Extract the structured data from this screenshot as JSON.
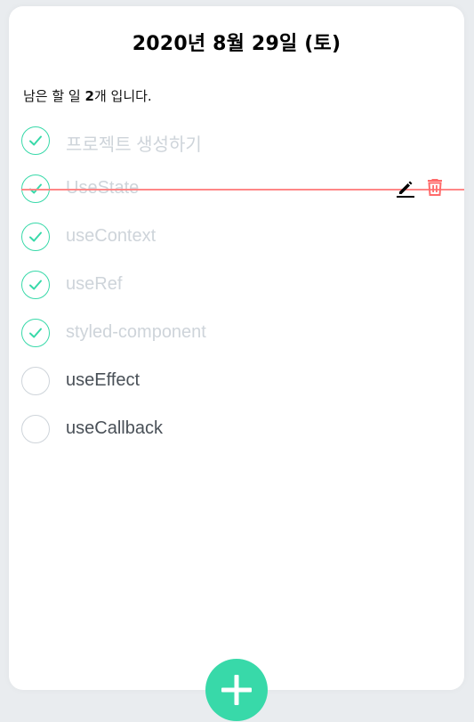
{
  "header": {
    "date_title": "2020년 8월 29일 (토)",
    "remaining_prefix": "남은 할 일 ",
    "remaining_count": "2",
    "remaining_suffix": "개 입니다."
  },
  "todos": [
    {
      "text": "프로젝트 생성하기",
      "done": true
    },
    {
      "text": "UseState",
      "done": true
    },
    {
      "text": "useContext",
      "done": true
    },
    {
      "text": "useRef",
      "done": true
    },
    {
      "text": "styled-component",
      "done": true
    },
    {
      "text": "useEffect",
      "done": false
    },
    {
      "text": "useCallback",
      "done": false
    }
  ],
  "icons": {
    "check": "check-icon",
    "edit": "pencil-icon",
    "delete": "trash-icon",
    "add": "plus-icon"
  },
  "colors": {
    "accent": "#38d9a9",
    "done_text": "#ced4da",
    "active_text": "#495057",
    "delete": "#ff6b6b",
    "strike_line": "#ff8787"
  }
}
